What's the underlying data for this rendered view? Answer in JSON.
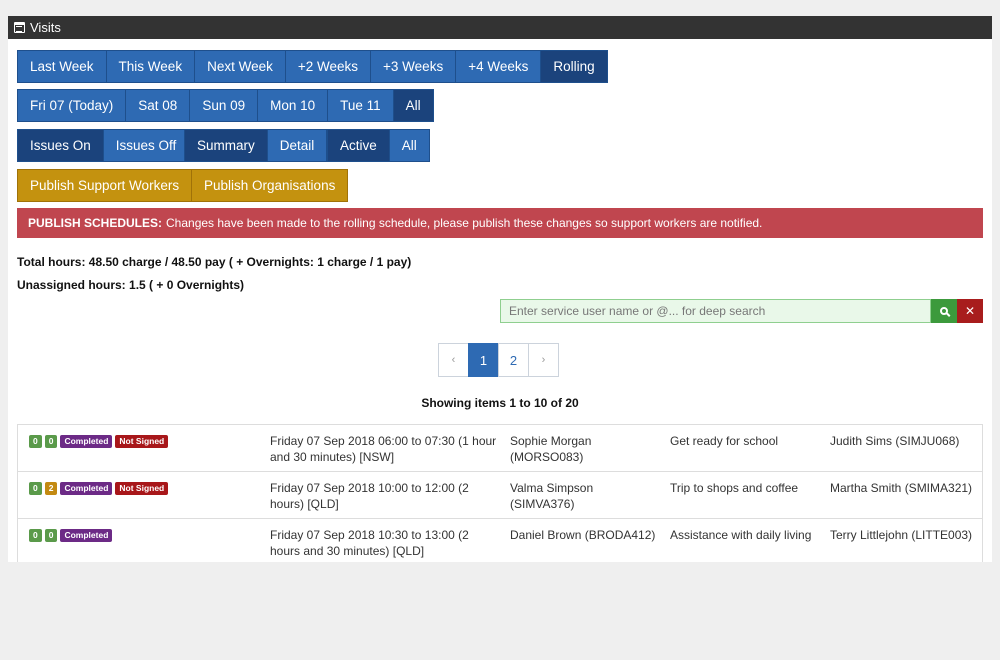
{
  "header": {
    "title": "Visits",
    "icon": "calendar-icon"
  },
  "week_buttons": [
    "Last Week",
    "This Week",
    "Next Week",
    "+2 Weeks",
    "+3 Weeks",
    "+4 Weeks",
    "Rolling"
  ],
  "day_buttons": [
    "Fri 07 (Today)",
    "Sat 08",
    "Sun 09",
    "Mon 10",
    "Tue 11",
    "All"
  ],
  "filter_buttons": {
    "issues_on": "Issues On",
    "issues_off": "Issues Off",
    "summary": "Summary",
    "detail": "Detail",
    "active": "Active",
    "all": "All"
  },
  "publish": {
    "support_workers": "Publish Support Workers",
    "organisations": "Publish Organisations"
  },
  "alert": {
    "title": "PUBLISH SCHEDULES:",
    "message": "Changes have been made to the rolling schedule, please publish these changes so support workers are notified."
  },
  "stats": {
    "total": "Total hours: 48.50 charge / 48.50 pay ( + Overnights: 1 charge / 1 pay)",
    "unassigned": "Unassigned hours: 1.5 ( + 0 Overnights)"
  },
  "search": {
    "placeholder": "Enter service user name or @... for deep search"
  },
  "pagination": {
    "prev": "‹",
    "pages": [
      "1",
      "2"
    ],
    "next": "›",
    "active": "1"
  },
  "showing": "Showing items 1 to 10 of 20",
  "visits": [
    {
      "badges": [
        {
          "text": "0",
          "color": "#5a9a4a"
        },
        {
          "text": "0",
          "color": "#5a9a4a"
        },
        {
          "text": "Completed",
          "color": "#6c2a86"
        },
        {
          "text": "Not Signed",
          "color": "#a8171a"
        }
      ],
      "time": "Friday 07 Sep 2018 06:00 to 07:30 (1 hour and 30 minutes) [NSW]",
      "service_user": "Sophie Morgan (MORSO083)",
      "task": "Get ready for school",
      "worker": "Judith Sims (SIMJU068)"
    },
    {
      "badges": [
        {
          "text": "0",
          "color": "#5a9a4a"
        },
        {
          "text": "2",
          "color": "#c38a12"
        },
        {
          "text": "Completed",
          "color": "#6c2a86"
        },
        {
          "text": "Not Signed",
          "color": "#a8171a"
        }
      ],
      "time": "Friday 07 Sep 2018 10:00 to 12:00 (2 hours) [QLD]",
      "service_user": "Valma Simpson (SIMVA376)",
      "task": "Trip to shops and coffee",
      "worker": "Martha Smith (SMIMA321)"
    },
    {
      "badges": [
        {
          "text": "0",
          "color": "#5a9a4a"
        },
        {
          "text": "0",
          "color": "#5a9a4a"
        },
        {
          "text": "Completed",
          "color": "#6c2a86"
        }
      ],
      "time": "Friday 07 Sep 2018 10:30 to 13:00 (2 hours and 30 minutes) [QLD]",
      "service_user": "Daniel Brown (BRODA412)",
      "task": "Assistance with daily living",
      "worker": "Terry Littlejohn (LITTE003)"
    }
  ]
}
